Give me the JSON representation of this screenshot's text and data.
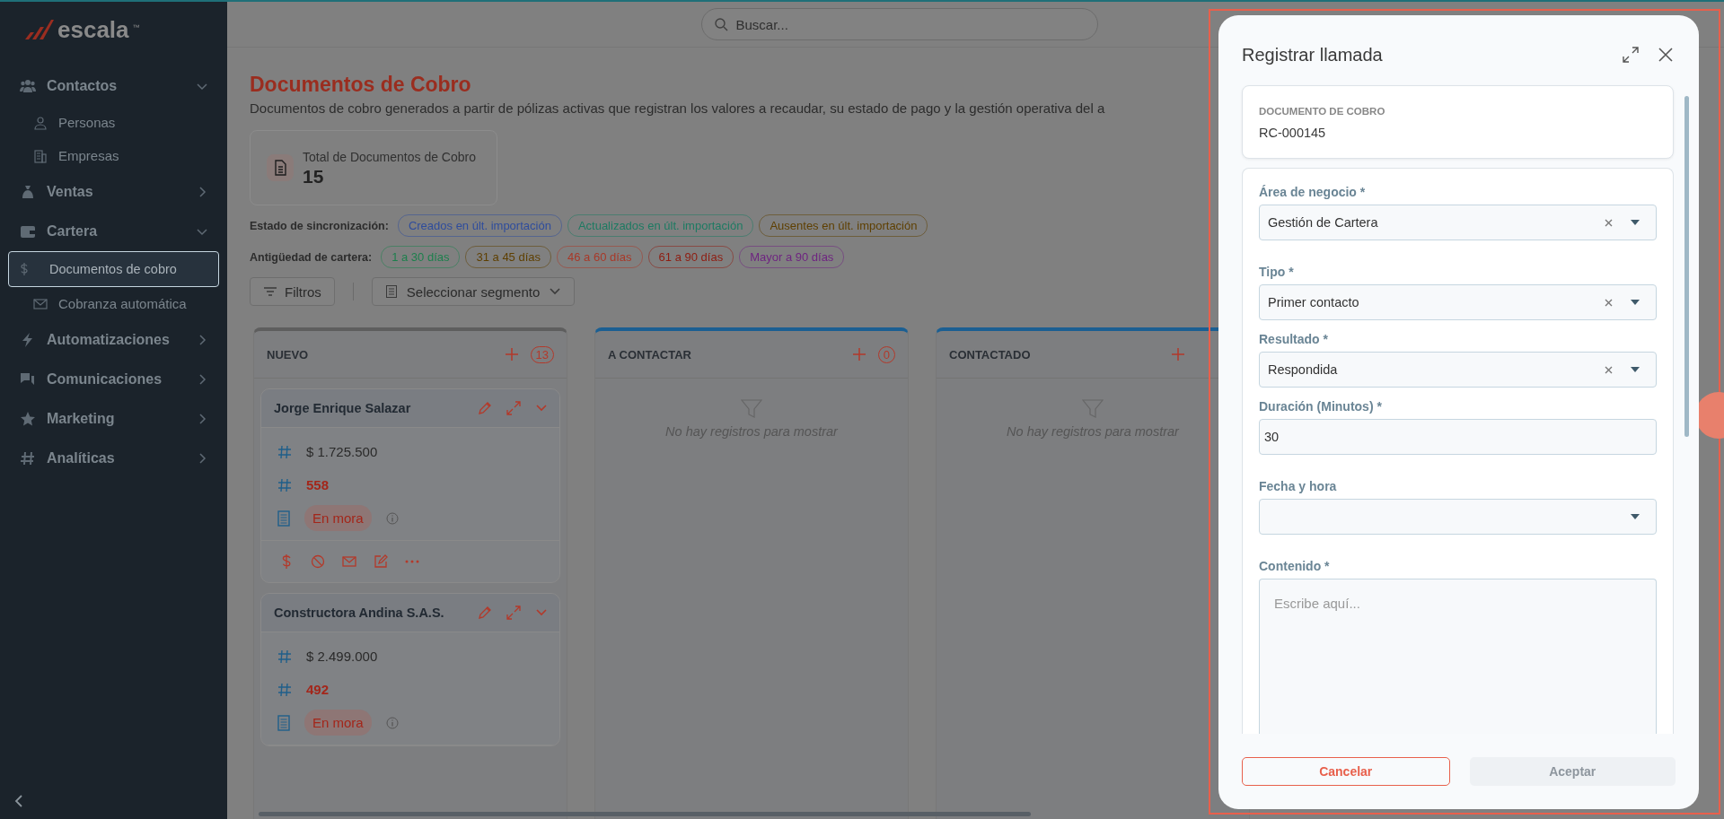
{
  "sidebar": {
    "logo": "escala",
    "trademark": "™",
    "items": [
      {
        "label": "Contactos",
        "expanded": true,
        "children": [
          {
            "label": "Personas",
            "selected": false
          },
          {
            "label": "Empresas",
            "selected": false
          }
        ]
      },
      {
        "label": "Ventas",
        "expanded": false
      },
      {
        "label": "Cartera",
        "expanded": true,
        "children": [
          {
            "label": "Documentos de cobro",
            "selected": true
          },
          {
            "label": "Cobranza automática",
            "selected": false
          }
        ]
      },
      {
        "label": "Automatizaciones",
        "expanded": false
      },
      {
        "label": "Comunicaciones",
        "expanded": false
      },
      {
        "label": "Marketing",
        "expanded": false
      },
      {
        "label": "Analíticas",
        "expanded": false
      }
    ]
  },
  "search": {
    "placeholder": "Buscar..."
  },
  "page": {
    "title": "Documentos de Cobro",
    "description": "Documentos de cobro generados a partir de pólizas activas que registran los valores a recaudar, su estado de pago y la gestión operativa del a"
  },
  "summary_card": {
    "label": "Total de Documentos de Cobro",
    "value": "15"
  },
  "filter_groups": [
    {
      "label": "Estado de sincronización:",
      "chips": [
        {
          "label": "Creados en últ. importación",
          "color": "#2e4c9c"
        },
        {
          "label": "Actualizados en últ. importación",
          "color": "#1d7a62"
        },
        {
          "label": "Ausentes en últ. importación",
          "color": "#5e3f00"
        }
      ]
    },
    {
      "label": "Antigüedad de cartera:",
      "chips": [
        {
          "label": "1 a 30 días",
          "color": "#1c7f4c"
        },
        {
          "label": "31 a 45 días",
          "color": "#5e3f00"
        },
        {
          "label": "46 a 60 días",
          "color": "#a83828"
        },
        {
          "label": "61 a 90 días",
          "color": "#8e1c10"
        },
        {
          "label": "Mayor a 90 días",
          "color": "#6e2480"
        }
      ]
    }
  ],
  "toolbar": {
    "filters_button": "Filtros",
    "segment_select": "Seleccionar segmento"
  },
  "columns": [
    {
      "title": "NUEVO",
      "count": "13",
      "color": "#5e5e5e",
      "cards": [
        {
          "name": "Jorge Enrique Salazar",
          "amount": "$ 1.725.500",
          "days": "558",
          "status": "En mora",
          "actions": true
        },
        {
          "name": "Constructora Andina S.A.S.",
          "amount": "$ 2.499.000",
          "days": "492",
          "status": "En mora",
          "actions": false
        }
      ]
    },
    {
      "title": "A CONTACTAR",
      "count": "0",
      "color": "#1b5f92",
      "empty_text": "No hay registros para mostrar"
    },
    {
      "title": "CONTACTADO",
      "color": "#1b5f92",
      "empty_text": "No hay registros para mostrar"
    }
  ],
  "dialog": {
    "title": "Registrar llamada",
    "required_mark": "*",
    "document": {
      "label": "DOCUMENTO DE COBRO",
      "value": "RC-000145"
    },
    "fields": [
      {
        "kind": "select",
        "label": "Área de negocio",
        "required": true,
        "value": "Gestión de Cartera",
        "clearable": true
      },
      {
        "kind": "select",
        "label": "Tipo",
        "required": true,
        "value": "Primer contacto",
        "clearable": true
      },
      {
        "kind": "select",
        "label": "Resultado",
        "required": true,
        "value": "Respondida",
        "clearable": true
      },
      {
        "kind": "input",
        "label": "Duración (Minutos)",
        "required": true,
        "value": "30"
      },
      {
        "kind": "select",
        "label": "Fecha y hora",
        "required": false,
        "clearable": false
      },
      {
        "kind": "textarea",
        "label": "Contenido",
        "required": true,
        "placeholder": "Escribe aquí..."
      }
    ],
    "buttons": [
      {
        "label": "Cancelar",
        "kind": "outline",
        "disabled": false
      },
      {
        "label": "Aceptar",
        "kind": "primary",
        "disabled": true
      }
    ]
  }
}
